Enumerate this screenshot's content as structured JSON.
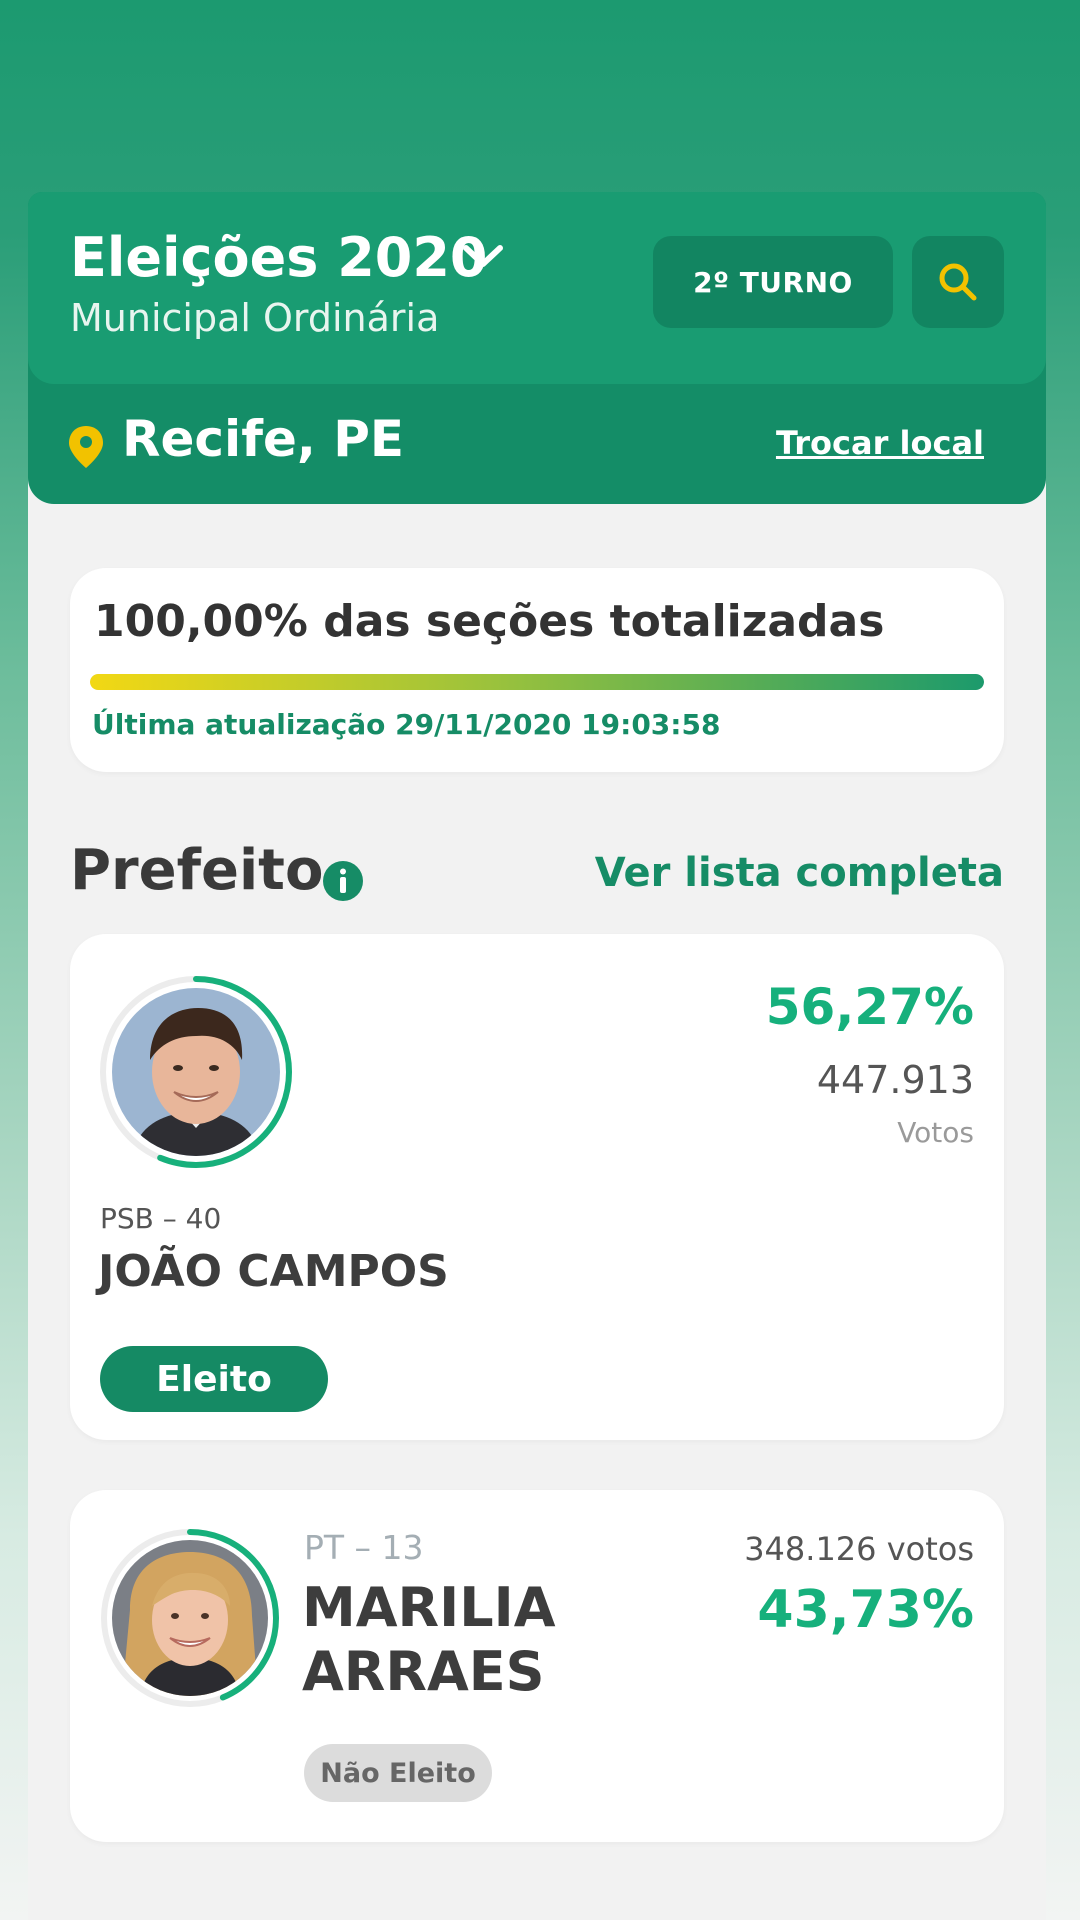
{
  "header": {
    "election_title": "Eleições 2020",
    "election_subtitle": "Municipal Ordinária",
    "turno_label": "2º TURNO",
    "location": "Recife, PE",
    "change_location_label": "Trocar local"
  },
  "progress": {
    "title": "100,00% das seções totalizadas",
    "fraction": 1.0,
    "last_update": "Última atualização 29/11/2020 19:03:58"
  },
  "section": {
    "title": "Prefeito",
    "see_all_label": "Ver lista completa"
  },
  "candidates": [
    {
      "party": "PSB – 40",
      "name": "JOÃO CAMPOS",
      "percent": "56,27%",
      "votes": "447.913",
      "votes_label": "Votos",
      "status": "Eleito",
      "share": 0.5627
    },
    {
      "party": "PT – 13",
      "name_line1": "MARILIA",
      "name_line2": "ARRAES",
      "percent": "43,73%",
      "votes": "348.126 votos",
      "status": "Não Eleito",
      "share": 0.4373
    }
  ],
  "colors": {
    "primary_green": "#199c72",
    "dark_green": "#148d67",
    "accent_green": "#16b07c",
    "pin_yellow": "#f2c200"
  },
  "icons": [
    "chevron-down-icon",
    "search-icon",
    "location-pin-icon",
    "info-icon"
  ]
}
